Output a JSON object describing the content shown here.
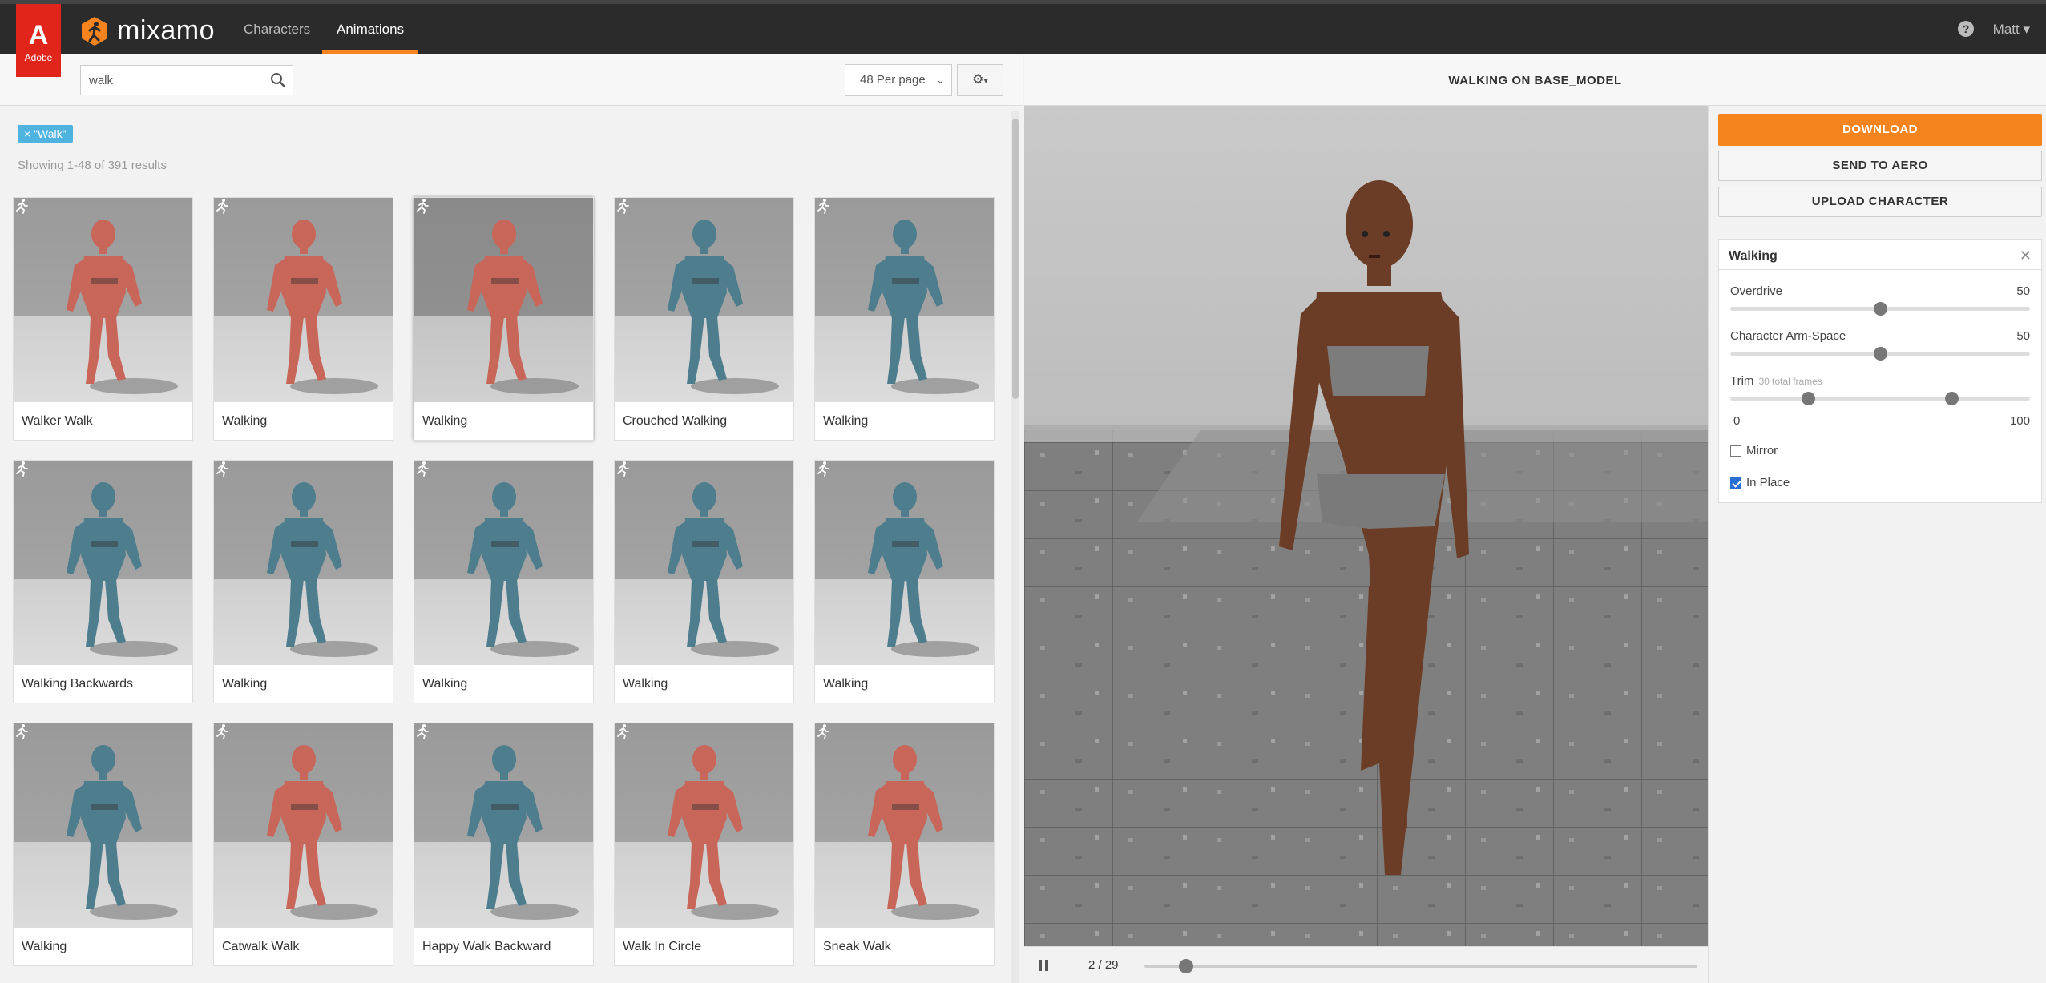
{
  "brand": {
    "adobe_label": "Adobe",
    "app_name": "mixamo",
    "accent_color": "#f5841f"
  },
  "nav": {
    "tabs": [
      {
        "label": "Characters",
        "active": false
      },
      {
        "label": "Animations",
        "active": true
      }
    ],
    "user": "Matt"
  },
  "search": {
    "query": "walk",
    "per_page": "48 Per page"
  },
  "filter_tag": "× \"Walk\"",
  "results_text": "Showing 1-48 of 391 results",
  "cards": [
    {
      "label": "Walker Walk",
      "tone": "red"
    },
    {
      "label": "Walking",
      "tone": "red"
    },
    {
      "label": "Walking",
      "tone": "red",
      "selected": true
    },
    {
      "label": "Crouched Walking",
      "tone": "teal"
    },
    {
      "label": "Walking",
      "tone": "teal"
    },
    {
      "label": "Walking Backwards",
      "tone": "teal"
    },
    {
      "label": "Walking",
      "tone": "teal"
    },
    {
      "label": "Walking",
      "tone": "teal"
    },
    {
      "label": "Walking",
      "tone": "teal"
    },
    {
      "label": "Walking",
      "tone": "teal"
    },
    {
      "label": "Walking",
      "tone": "teal"
    },
    {
      "label": "Catwalk Walk",
      "tone": "red"
    },
    {
      "label": "Happy Walk Backward",
      "tone": "teal"
    },
    {
      "label": "Walk In Circle",
      "tone": "red"
    },
    {
      "label": "Sneak Walk",
      "tone": "red"
    }
  ],
  "viewer": {
    "title": "WALKING ON BASE_MODEL",
    "frame_counter": "2 / 29",
    "timeline_progress": 0.075
  },
  "actions": {
    "download": "DOWNLOAD",
    "send_aero": "SEND TO AERO",
    "upload": "UPLOAD CHARACTER"
  },
  "settings": {
    "title": "Walking",
    "overdrive": {
      "label": "Overdrive",
      "value": "50",
      "fraction": 0.5
    },
    "arm_space": {
      "label": "Character Arm-Space",
      "value": "50",
      "fraction": 0.5
    },
    "trim": {
      "label": "Trim",
      "sub": "30 total frames",
      "min": "0",
      "max": "100",
      "start_fraction": 0.26,
      "end_fraction": 0.74
    },
    "mirror": {
      "label": "Mirror",
      "checked": false
    },
    "in_place": {
      "label": "In Place",
      "checked": true
    }
  }
}
